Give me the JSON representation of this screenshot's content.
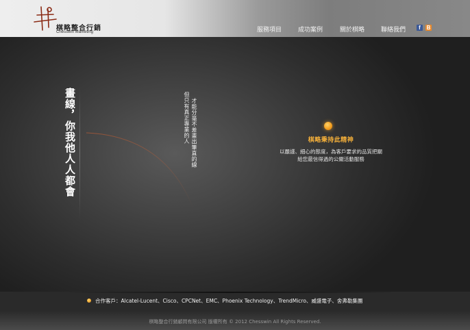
{
  "header": {
    "logo_cn": "棋略整合行銷",
    "logo_en": "Chesswin Marketing",
    "nav": [
      {
        "label": "服務項目"
      },
      {
        "label": "成功案例"
      },
      {
        "label": "關於棋略"
      },
      {
        "label": "聯絡我們"
      }
    ],
    "social": {
      "facebook_glyph": "f",
      "blog_glyph": "B"
    }
  },
  "hero": {
    "big_vertical": "畫線，你我他人人都會",
    "small_vertical_1": "才能分毫不差畫出筆直的線",
    "small_vertical_2": "但只有真正專業的人",
    "spirit_title": "棋略秉持此精神",
    "spirit_line_1": "以嚴謹、細心的態度，為客戶要求的品質把關",
    "spirit_line_2": "給您最信得過的公關活動服務"
  },
  "partners": {
    "text": "合作客戶：Alcatel-Lucent、Cisco、CPCNet、EMC、Phoenix Technology、TrendMicro、威盛電子、舍弗勒集團"
  },
  "footer": {
    "copyright": "棋略整合行銷顧問有限公司 版權所有 © 2012 Chesswin All Rights Reserved."
  },
  "colors": {
    "accent_orange": "#f5a020",
    "spirit_title": "#f5b03a"
  }
}
